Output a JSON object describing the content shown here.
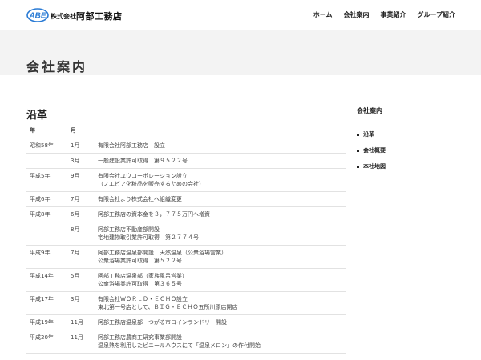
{
  "header": {
    "logo_mark": "ABE",
    "logo_prefix": "株式会社",
    "logo_name": "阿部工務店",
    "nav": [
      "ホーム",
      "会社案内",
      "事業紹介",
      "グループ紹介"
    ]
  },
  "page_title": "会社案内",
  "history": {
    "title": "沿革",
    "col_era": "年",
    "col_month": "月",
    "rows": [
      {
        "era": "昭和58年",
        "month": "1月",
        "lines": [
          "有限会社阿部工務店　設立"
        ]
      },
      {
        "era": "",
        "month": "3月",
        "lines": [
          "一般建設業許可取得　第９５２２号"
        ]
      },
      {
        "era": "平成5年",
        "month": "9月",
        "lines": [
          "有限会社ユウコーポレーション設立",
          "（ノエビア化粧品を販売するための会社）"
        ]
      },
      {
        "era": "平成6年",
        "month": "7月",
        "lines": [
          "有限会社より株式会社へ組織変更"
        ]
      },
      {
        "era": "平成8年",
        "month": "6月",
        "lines": [
          "阿部工務店の資本金を３，７７５万円へ増資"
        ]
      },
      {
        "era": "",
        "month": "8月",
        "lines": [
          "阿部工務店不動産部開設",
          "宅地建物取引業許可取得　第２７７４号"
        ]
      },
      {
        "era": "平成9年",
        "month": "7月",
        "lines": [
          "阿部工務店温泉部開設　天然温泉（公衆浴場営業）",
          "公衆浴場業許可取得　第５２２号"
        ]
      },
      {
        "era": "平成14年",
        "month": "5月",
        "lines": [
          "阿部工務店温泉部（家族風呂営業）",
          "公衆浴場業許可取得　第３６５号"
        ]
      },
      {
        "era": "平成17年",
        "month": "3月",
        "lines": [
          "有限会社ＷＯＲＬＤ・ＥＣＨＯ設立",
          "東北第一号店として、ＢＩＧ・ＥＣＨＯ五所川原店開店"
        ]
      },
      {
        "era": "平成19年",
        "month": "11月",
        "lines": [
          "阿部工務店温泉部　つがる市コインランドリー開設"
        ]
      },
      {
        "era": "平成20年",
        "month": "11月",
        "lines": [
          "阿部工務店農商工研究事業部開設",
          "温泉熱を利用したビニールハウスにて「温泉メロン」の作付開始"
        ]
      }
    ]
  },
  "sidebar": {
    "title": "会社案内",
    "items": [
      "沿革",
      "会社概要",
      "本社地図"
    ]
  },
  "colors": {
    "band": "#f3f3f3",
    "logo_blue": "#2a7bd5",
    "text": "#333333"
  }
}
